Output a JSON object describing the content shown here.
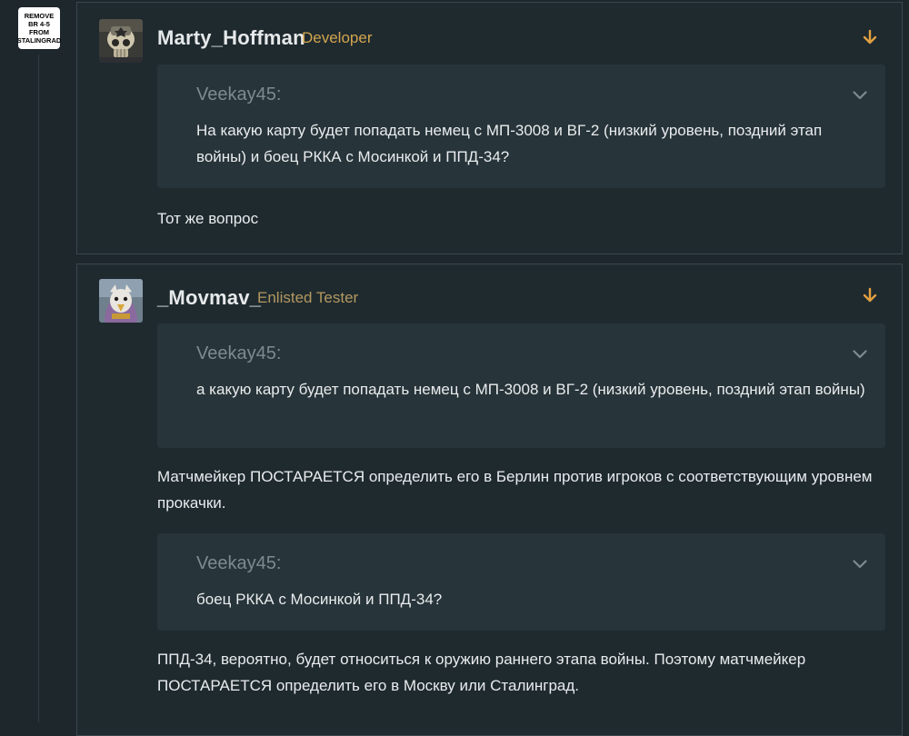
{
  "sidebar_badge": {
    "lines": [
      "REMOVE",
      "BR 4-5",
      "FROM",
      "STALINGRAD"
    ]
  },
  "posts": [
    {
      "username": "Marty_Hoffman",
      "role": "Developer",
      "avatar_icon": "skull-helmet-avatar",
      "quotes": [
        {
          "author": "Veekay45:",
          "text": "На какую карту будет попадать немец с МП-3008 и ВГ-2 (низкий уровень, поздний этап войны) и боец РККА с Мосинкой и ППД-34?"
        }
      ],
      "texts": [
        "Тот же вопрос"
      ]
    },
    {
      "username": "_Movmav_",
      "role": "Enlisted Tester",
      "avatar_icon": "bird-avatar",
      "quotes": [
        {
          "author": "Veekay45:",
          "text": "а какую карту будет попадать немец с МП-3008 и ВГ-2 (низкий уровень, поздний этап войны)"
        },
        {
          "author": "Veekay45:",
          "text": "боец РККА с Мосинкой и ППД-34?"
        }
      ],
      "texts": [
        "Матчмейкер ПОСТАРАЕТСЯ определить его в Берлин против игроков с соответствующим уровнем прокачки.",
        "ППД-34, вероятно, будет относиться к оружию раннего этапа войны. Поэтому матчмейкер ПОСТАРАЕТСЯ определить его в Москву или Сталинград."
      ]
    }
  ],
  "colors": {
    "background": "#1d272c",
    "quote_bg": "#273439",
    "developer_role": "#d2a54e",
    "tester_role": "#b3985f",
    "jump_arrow": "#e0a040"
  }
}
